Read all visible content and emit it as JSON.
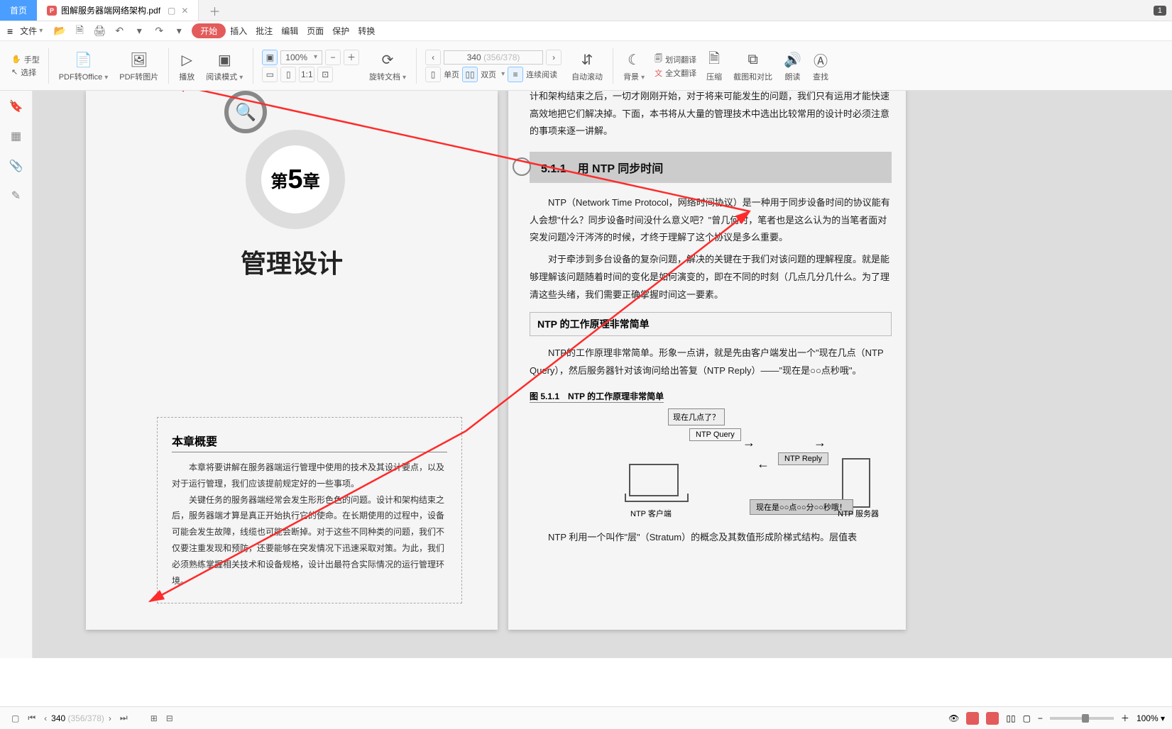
{
  "tabs": {
    "home": "首页",
    "doc_badge": "P",
    "doc_name": "图解服务器端网络架构.pdf"
  },
  "window_count": "1",
  "menu": {
    "file": "文件",
    "icons": [
      "folder-open-icon",
      "save-icon",
      "print-icon",
      "undo-icon",
      "chev-icon",
      "redo-icon",
      "chev-icon"
    ],
    "start": "开始",
    "insert": "插入",
    "annotate": "批注",
    "edit": "编辑",
    "page": "页面",
    "protect": "保护",
    "convert": "转换"
  },
  "ribbon": {
    "hand": "手型",
    "select": "选择",
    "pdf_office": "PDF转Office",
    "pdf_image": "PDF转图片",
    "play": "播放",
    "read_mode": "阅读模式",
    "zoom": "100%",
    "rotate": "旋转文档",
    "single": "单页",
    "double": "双页",
    "continuous": "连续阅读",
    "autoscroll": "自动滚动",
    "page_current": "340",
    "page_total": "(356/378)",
    "bg": "背景",
    "ocr_trans": "划词翻译",
    "full_trans": "全文翻译",
    "compress": "压缩",
    "screenshot": "截图和对比",
    "read_aloud": "朗读",
    "find": "查找"
  },
  "left_page": {
    "chapter_prefix": "第",
    "chapter_num": "5",
    "chapter_suffix": "章",
    "title": "管理设计",
    "overview_heading": "本章概要",
    "overview_p1": "本章将要讲解在服务器端运行管理中使用的技术及其设计要点，以及对于运行管理，我们应该提前规定好的一些事项。",
    "overview_p2": "关键任务的服务器端经常会发生形形色色的问题。设计和架构结束之后，服务器端才算是真正开始执行它的使命。在长期使用的过程中，设备可能会发生故障，线缆也可能会断掉。对于这些不同种类的问题，我们不仅要注重发现和预防，还要能够在突发情况下迅速采取对策。为此，我们必须熟练掌握相关技术和设备规格，设计出最符合实际情况的运行管理环境。"
  },
  "right_page": {
    "intro": "计和架构结束之后，一切才刚刚开始，对于将来可能发生的问题，我们只有运用才能快速高效地把它们解决掉。下面，本书将从大量的管理技术中选出比较常用的设计时必须注意的事项来逐一讲解。",
    "section": "5.1.1　用 NTP 同步时间",
    "p1": "NTP（Network Time Protocol，网络时间协议）是一种用于同步设备时间的协议能有人会想\"什么？同步设备时间没什么意义吧？\"曾几何时，笔者也是这么认为的当笔者面对突发问题冷汗涔涔的时候，才终于理解了这个协议是多么重要。",
    "p2": "对于牵涉到多台设备的复杂问题，解决的关键在于我们对该问题的理解程度。就是能够理解该问题随着时间的变化是如何演变的，即在不同的时刻（几点几分几什么。为了理清这些头绪，我们需要正确掌握时间这一要素。",
    "sub": "NTP 的工作原理非常简单",
    "p3": "NTP的工作原理非常简单。形象一点讲，就是先由客户端发出一个\"现在几点（NTP Query），然后服务器针对该询问给出答复（NTP Reply）——\"现在是○○点秒哦\"。",
    "fig_label": "图 5.1.1　NTP 的工作原理非常简单",
    "bubble": "现在几点了？",
    "query": "NTP Query",
    "reply": "NTP Reply",
    "timebox": "现在是○○点○○分○○秒哦！",
    "client": "NTP 客户端",
    "server": "NTP 服务器",
    "p4": "NTP 利用一个叫作\"层\"（Stratum）的概念及其数值形成阶梯式结构。层值表"
  },
  "status": {
    "page_current": "340",
    "page_total": "(356/378)",
    "zoom": "100%"
  }
}
